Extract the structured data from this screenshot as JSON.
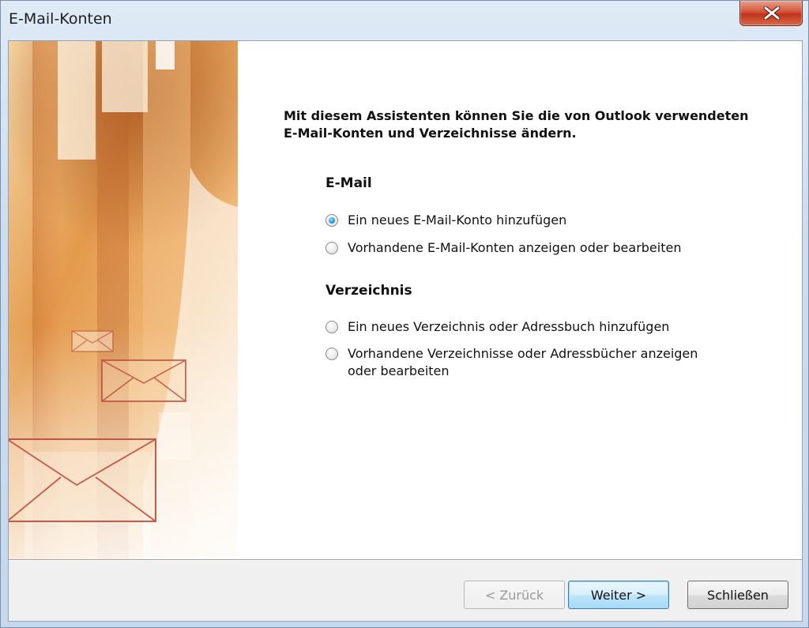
{
  "window": {
    "title": "E-Mail-Konten"
  },
  "wizard": {
    "intro": "Mit diesem Assistenten können Sie die von Outlook verwendeten E-Mail-Konten und Verzeichnisse ändern.",
    "email_group": {
      "heading": "E-Mail",
      "options": [
        {
          "label": "Ein neues E-Mail-Konto hinzufügen",
          "selected": true
        },
        {
          "label": "Vorhandene E-Mail-Konten anzeigen oder bearbeiten",
          "selected": false
        }
      ]
    },
    "directory_group": {
      "heading": "Verzeichnis",
      "options": [
        {
          "label": "Ein neues Verzeichnis oder Adressbuch hinzufügen",
          "selected": false
        },
        {
          "label": "Vorhandene Verzeichnisse oder Adressbücher anzeigen oder bearbeiten",
          "selected": false
        }
      ]
    }
  },
  "buttons": {
    "back": "< Zurück",
    "next": "Weiter >",
    "close": "Schließen"
  },
  "colors": {
    "art_orange": "#e08a3a",
    "art_dark": "#b05a22",
    "envelope_line": "#c04a3a",
    "default_button_border": "#3c7fb1"
  },
  "icons": {
    "close": "close-x-icon",
    "envelope": "envelope-icon"
  }
}
